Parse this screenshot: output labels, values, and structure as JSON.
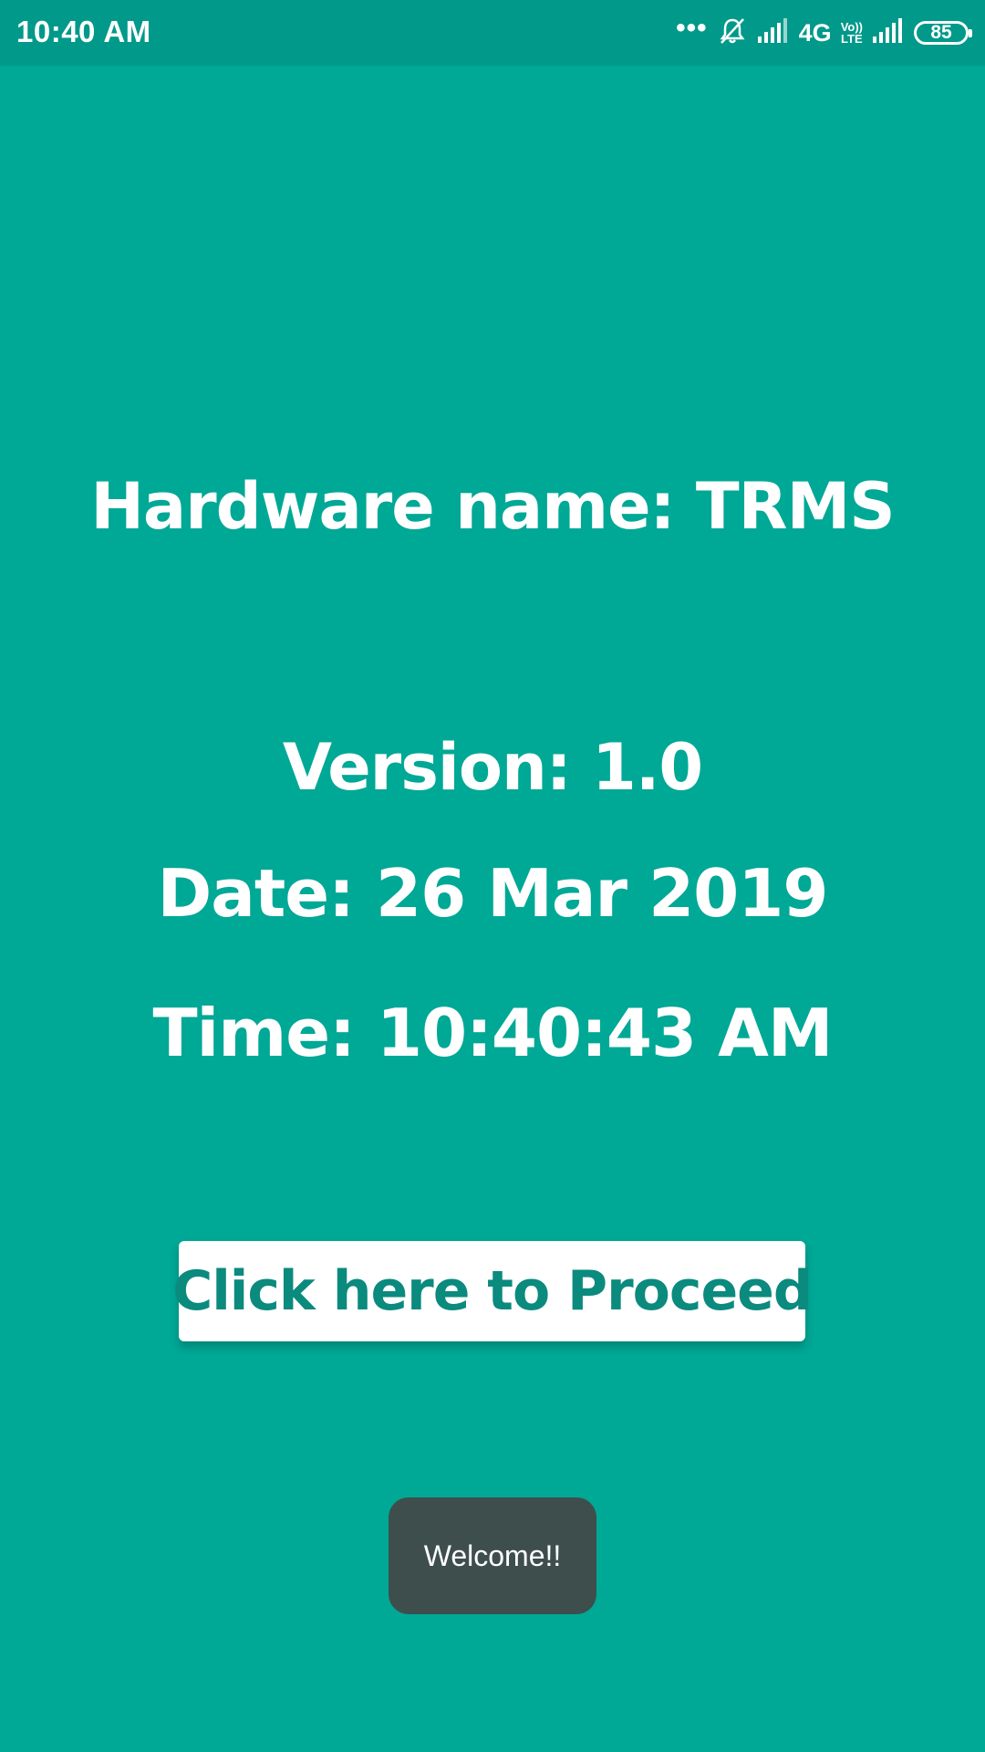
{
  "status_bar": {
    "time": "10:40 AM",
    "network_type": "4G",
    "volte_top": "Vo))",
    "volte_bottom": "LTE",
    "battery_level": "85",
    "icons": [
      "more-dots-icon",
      "notifications-muted-icon",
      "signal-icon",
      "volte-icon",
      "battery-icon"
    ]
  },
  "main": {
    "hardware_line": "Hardware name: TRMS",
    "version_line": "Version: 1.0",
    "date_line": "Date: 26 Mar 2019",
    "time_line": "Time: 10:40:43 AM",
    "proceed_label": "Click here to Proceed"
  },
  "toast": {
    "message": "Welcome!!"
  },
  "colors": {
    "background": "#00a896",
    "status_bar": "#00998a",
    "button_text": "#0b8a7e",
    "toast_bg": "#3e4e4c"
  }
}
